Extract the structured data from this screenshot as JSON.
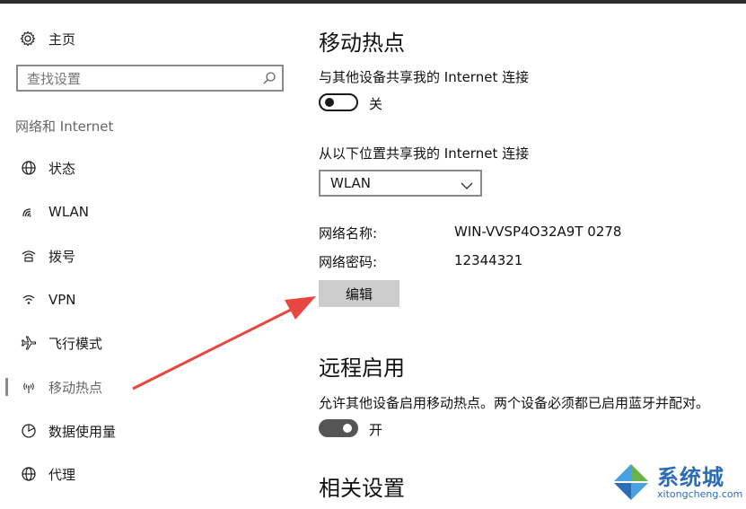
{
  "sidebar": {
    "home_label": "主页",
    "search_placeholder": "查找设置",
    "section_title": "网络和 Internet",
    "items": [
      {
        "label": "状态",
        "icon": "globe-status-icon"
      },
      {
        "label": "WLAN",
        "icon": "wifi-icon"
      },
      {
        "label": "拨号",
        "icon": "dialup-icon"
      },
      {
        "label": "VPN",
        "icon": "vpn-icon"
      },
      {
        "label": "飞行模式",
        "icon": "airplane-icon"
      },
      {
        "label": "移动热点",
        "icon": "hotspot-icon",
        "active": true
      },
      {
        "label": "数据使用量",
        "icon": "data-usage-icon"
      },
      {
        "label": "代理",
        "icon": "proxy-globe-icon"
      }
    ]
  },
  "main": {
    "title": "移动热点",
    "share_label": "与其他设备共享我的 Internet 连接",
    "share_toggle_state": "关",
    "share_from_label": "从以下位置共享我的 Internet 连接",
    "share_from_value": "WLAN",
    "network_name_label": "网络名称:",
    "network_name_value": "WIN-VVSP4O32A9T 0278",
    "network_password_label": "网络密码:",
    "network_password_value": "12344321",
    "edit_button": "编辑",
    "remote_title": "远程启用",
    "remote_desc": "允许其他设备启用移动热点。两个设备必须都已启用蓝牙并配对。",
    "remote_toggle_state": "开",
    "related_title": "相关设置"
  },
  "watermark": {
    "brand": "系统城",
    "domain": "xitongcheng.com"
  },
  "colors": {
    "annotation_arrow": "#e8463f",
    "watermark_blue": "#2a6db5"
  }
}
